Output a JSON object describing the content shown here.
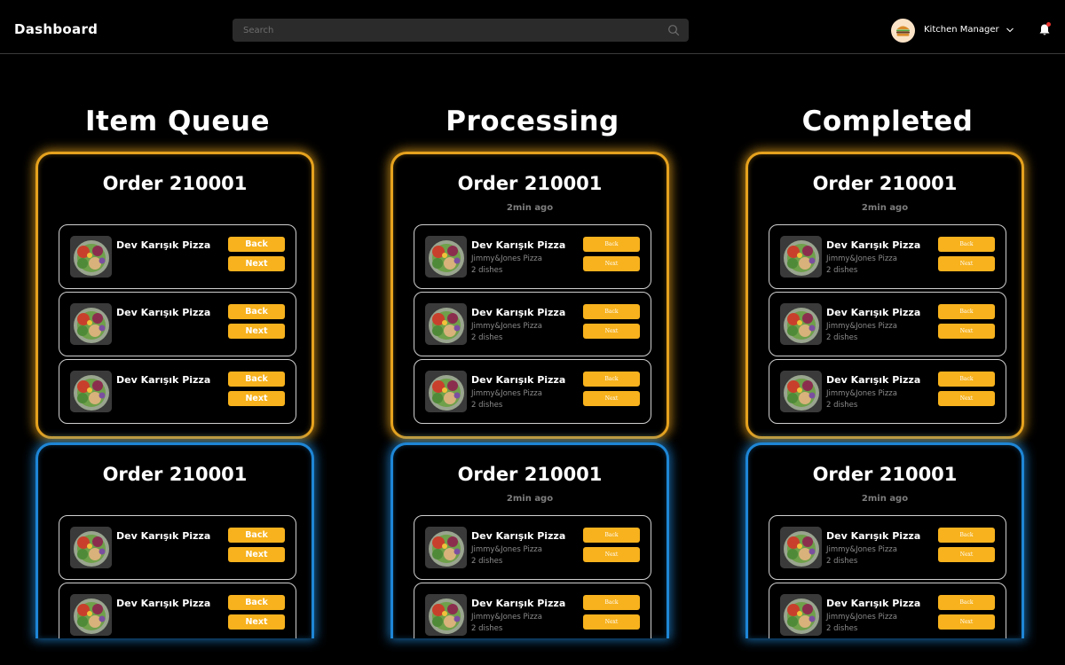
{
  "header": {
    "title": "Dashboard",
    "search_placeholder": "Search",
    "user_name": "Kitchen Manager"
  },
  "icons": {
    "search": "search-icon",
    "chevron": "chevron-down-icon",
    "notifications": "bell-icon",
    "avatar": "burger-avatar"
  },
  "colors": {
    "accent_gold": "#e6a21e",
    "accent_blue": "#1e86d6",
    "button": "#f7b21d",
    "notification_dot": "#e5322d"
  },
  "columns": [
    {
      "title": "Item Queue",
      "orders": [
        {
          "title": "Order 210001",
          "time": "",
          "variant": "gold",
          "items": [
            {
              "name": "Dev Karışık Pizza",
              "shop": "",
              "qty": "",
              "back": "Back",
              "next": "Next"
            },
            {
              "name": "Dev Karışık Pizza",
              "shop": "",
              "qty": "",
              "back": "Back",
              "next": "Next"
            },
            {
              "name": "Dev Karışık Pizza",
              "shop": "",
              "qty": "",
              "back": "Back",
              "next": "Next"
            }
          ]
        },
        {
          "title": "Order 210001",
          "time": "",
          "variant": "blue",
          "items": [
            {
              "name": "Dev Karışık Pizza",
              "shop": "",
              "qty": "",
              "back": "Back",
              "next": "Next"
            },
            {
              "name": "Dev Karışık Pizza",
              "shop": "",
              "qty": "",
              "back": "Back",
              "next": "Next"
            }
          ]
        }
      ]
    },
    {
      "title": "Processing",
      "orders": [
        {
          "title": "Order 210001",
          "time": "2min ago",
          "variant": "gold",
          "items": [
            {
              "name": "Dev Karışık Pizza",
              "shop": "Jimmy&Jones Pizza",
              "qty": "2 dishes",
              "back": "Back",
              "next": "Next"
            },
            {
              "name": "Dev Karışık Pizza",
              "shop": "Jimmy&Jones Pizza",
              "qty": "2 dishes",
              "back": "Back",
              "next": "Next"
            },
            {
              "name": "Dev Karışık Pizza",
              "shop": "Jimmy&Jones Pizza",
              "qty": "2 dishes",
              "back": "Back",
              "next": "Next"
            }
          ]
        },
        {
          "title": "Order 210001",
          "time": "2min ago",
          "variant": "blue",
          "items": [
            {
              "name": "Dev Karışık Pizza",
              "shop": "Jimmy&Jones Pizza",
              "qty": "2 dishes",
              "back": "Back",
              "next": "Next"
            },
            {
              "name": "Dev Karışık Pizza",
              "shop": "Jimmy&Jones Pizza",
              "qty": "2 dishes",
              "back": "Back",
              "next": "Next"
            }
          ]
        }
      ]
    },
    {
      "title": "Completed",
      "orders": [
        {
          "title": "Order 210001",
          "time": "2min ago",
          "variant": "gold",
          "items": [
            {
              "name": "Dev Karışık Pizza",
              "shop": "Jimmy&Jones Pizza",
              "qty": "2 dishes",
              "back": "Back",
              "next": "Next"
            },
            {
              "name": "Dev Karışık Pizza",
              "shop": "Jimmy&Jones Pizza",
              "qty": "2 dishes",
              "back": "Back",
              "next": "Next"
            },
            {
              "name": "Dev Karışık Pizza",
              "shop": "Jimmy&Jones Pizza",
              "qty": "2 dishes",
              "back": "Back",
              "next": "Next"
            }
          ]
        },
        {
          "title": "Order 210001",
          "time": "2min ago",
          "variant": "blue",
          "items": [
            {
              "name": "Dev Karışık Pizza",
              "shop": "Jimmy&Jones Pizza",
              "qty": "2 dishes",
              "back": "Back",
              "next": "Next"
            },
            {
              "name": "Dev Karışık Pizza",
              "shop": "Jimmy&Jones Pizza",
              "qty": "2 dishes",
              "back": "Back",
              "next": "Next"
            }
          ]
        }
      ]
    }
  ]
}
